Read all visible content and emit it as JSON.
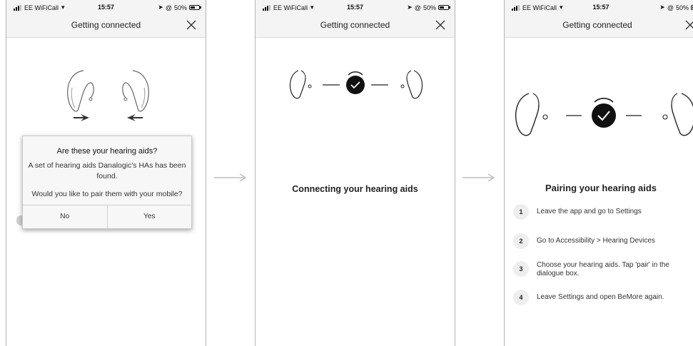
{
  "status_bar": {
    "carrier": "EE WiFiCall",
    "time": "15:57",
    "battery": "50%",
    "battery_level": 0.5
  },
  "screens": [
    {
      "nav_title": "Getting connected",
      "dialog": {
        "title": "Are these your hearing aids?",
        "message": "A set of hearing aids Danalogic's HAs has been found.",
        "question": "Would you like to pair them with your mobile?",
        "no_label": "No",
        "yes_label": "Yes"
      }
    },
    {
      "nav_title": "Getting connected",
      "status_text": "Connecting your hearing aids"
    },
    {
      "nav_title": "Getting connected",
      "heading": "Pairing your hearing aids",
      "steps": [
        {
          "num": "1",
          "text": "Leave the app and go to Settings"
        },
        {
          "num": "2",
          "text": "Go to Accessibility > Hearing Devices"
        },
        {
          "num": "3",
          "text": "Choose your hearing aids. Tap 'pair' in the dialogue box."
        },
        {
          "num": "4",
          "text": "Leave Settings and open BeMore again."
        }
      ]
    }
  ],
  "icons": {
    "close": "close-icon",
    "flow_arrow": "arrow-right-icon",
    "hearing_aids": "hearing-aids-icon",
    "connected": "checkmark-icon"
  },
  "colors": {
    "nav_bg": "#f4f4f4",
    "dialog_bg": "#f7f7f7",
    "check_circle": "#111111",
    "arrow": "#b0b0b0"
  }
}
